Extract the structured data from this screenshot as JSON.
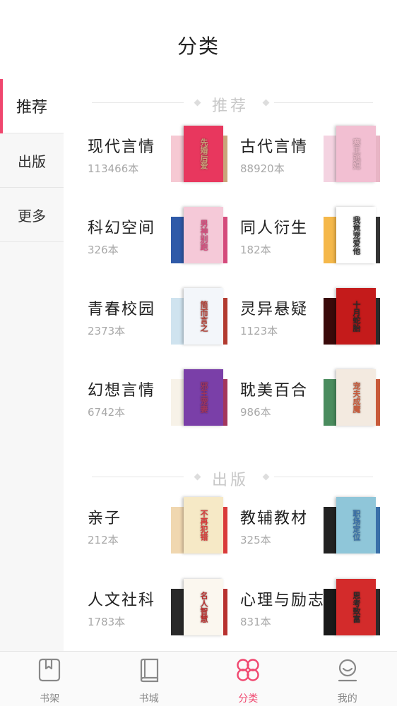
{
  "header": {
    "title": "分类"
  },
  "sidebar": {
    "items": [
      {
        "label": "推荐",
        "active": true
      },
      {
        "label": "出版",
        "active": false
      },
      {
        "label": "更多",
        "active": false
      }
    ]
  },
  "sections": [
    {
      "title": "推荐",
      "categories": [
        {
          "name": "现代言情",
          "count": "113466本",
          "cover_text": "先婚后爱",
          "colors": [
            "#f6c9d3",
            "#e8375e",
            "#c9a57a"
          ]
        },
        {
          "name": "古代言情",
          "count": "88920本",
          "cover_text": "寒王逃妃",
          "colors": [
            "#f4d3e1",
            "#f2bfd2",
            "#e8b5c5"
          ]
        },
        {
          "name": "科幻空间",
          "count": "326本",
          "cover_text": "男神别跑",
          "colors": [
            "#2f5aa8",
            "#f5c9d8",
            "#d44a7b"
          ]
        },
        {
          "name": "同人衍生",
          "count": "182本",
          "cover_text": "我竟宠爱他",
          "colors": [
            "#f5b84a",
            "#ffffff",
            "#333333"
          ]
        },
        {
          "name": "青春校园",
          "count": "2373本",
          "cover_text": "简而言之",
          "colors": [
            "#cfe3ef",
            "#f3f6fa",
            "#b23a2f"
          ]
        },
        {
          "name": "灵异悬疑",
          "count": "1123本",
          "cover_text": "十月蛇胎",
          "colors": [
            "#3a0a0a",
            "#c41b1b",
            "#2a2a2a"
          ]
        },
        {
          "name": "幻想言情",
          "count": "6742本",
          "cover_text": "邪王宠妻",
          "colors": [
            "#f7f2e8",
            "#7a3fa8",
            "#a3365d"
          ]
        },
        {
          "name": "耽美百合",
          "count": "986本",
          "cover_text": "宠夫成魔",
          "colors": [
            "#4a8c5e",
            "#f3eae0",
            "#c85a3a"
          ]
        }
      ]
    },
    {
      "title": "出版",
      "categories": [
        {
          "name": "亲子",
          "count": "212本",
          "cover_text": "不再犯错",
          "colors": [
            "#f0d7b0",
            "#f6e9c6",
            "#d93a3a"
          ]
        },
        {
          "name": "教辅教材",
          "count": "325本",
          "cover_text": "职场定位",
          "colors": [
            "#222222",
            "#8fc6d9",
            "#3a6fa8"
          ]
        },
        {
          "name": "人文社科",
          "count": "1783本",
          "cover_text": "名人智慧",
          "colors": [
            "#2a2a2a",
            "#fbf7ef",
            "#b8312f"
          ]
        },
        {
          "name": "心理与励志",
          "count": "831本",
          "cover_text": "思考致富",
          "colors": [
            "#1a1a1a",
            "#d32b2b",
            "#2a2a2a"
          ]
        }
      ]
    }
  ],
  "tabbar": {
    "items": [
      {
        "label": "书架",
        "icon": "bookmark-book-icon",
        "active": false
      },
      {
        "label": "书城",
        "icon": "book-icon",
        "active": false
      },
      {
        "label": "分类",
        "icon": "category-grid-icon",
        "active": true
      },
      {
        "label": "我的",
        "icon": "user-icon",
        "active": false
      }
    ]
  },
  "colors": {
    "accent": "#f0466e",
    "inactive": "#888888",
    "divider": "#e6e6e6"
  }
}
